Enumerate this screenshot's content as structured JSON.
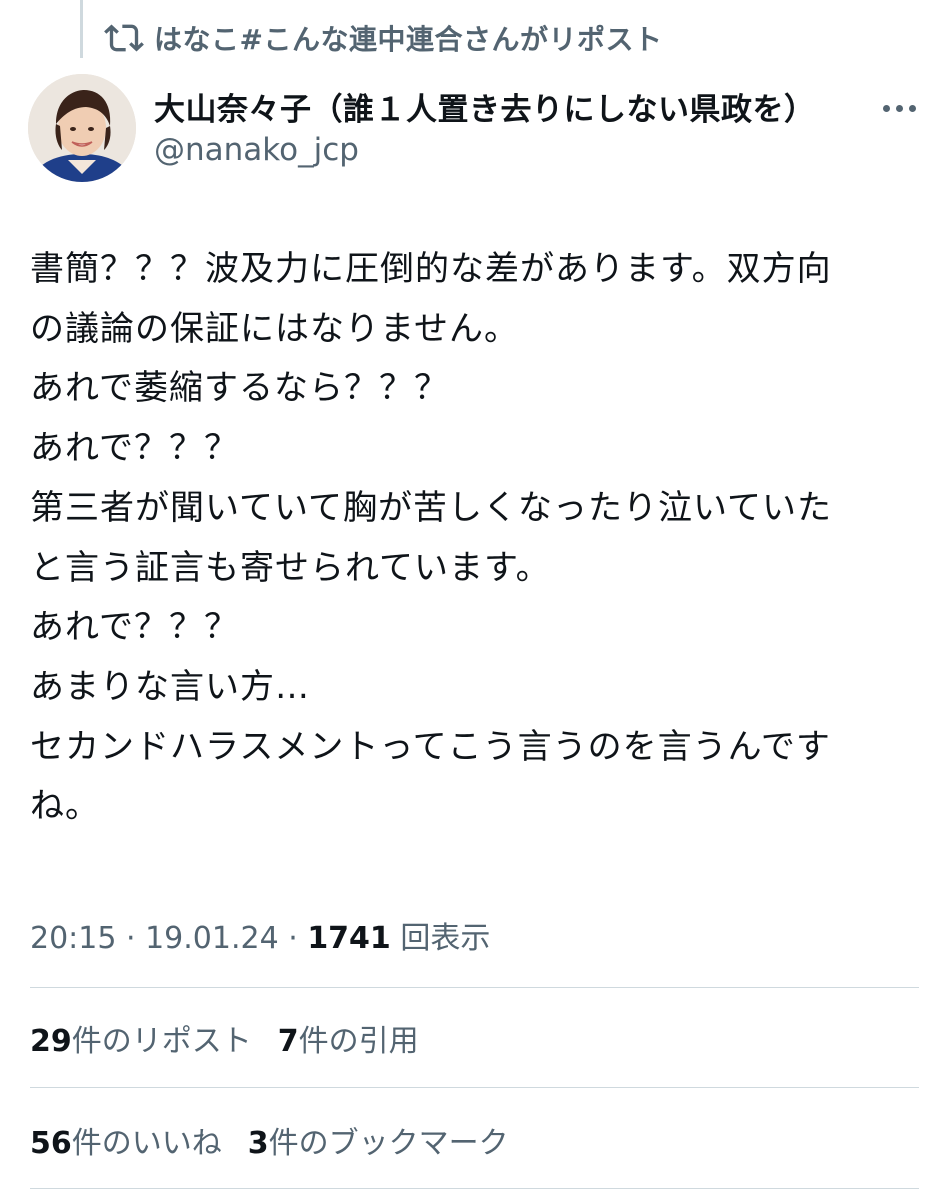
{
  "repost": {
    "text": "はなこ#こんな連中連合さんがリポスト",
    "icon": "repost-icon"
  },
  "author": {
    "display_name": "大山奈々子（誰１人置き去りにしない県政を）",
    "handle": "@nanako_jcp",
    "avatar_icon": "avatar-photo"
  },
  "tweet": {
    "lines": [
      "書簡？？？波及力に圧倒的な差があります。双方向",
      "の議論の保証にはなりません。",
      "あれで萎縮するなら？？？",
      "あれで？？？",
      "第三者が聞いていて胸が苦しくなったり泣いていた",
      "と言う証言も寄せられています。",
      "あれで？？？",
      "あまりな言い方…",
      "セカンドハラスメントってこう言うのを言うんです",
      "ね。"
    ]
  },
  "meta": {
    "time": "20:15",
    "date": "19.01.24",
    "views_count": "1741",
    "views_label": "回表示"
  },
  "stats_row1": {
    "reposts_count": "29",
    "reposts_label": "件のリポスト",
    "quotes_count": "7",
    "quotes_label": "件の引用"
  },
  "stats_row2": {
    "likes_count": "56",
    "likes_label": "件のいいね",
    "bookmarks_count": "3",
    "bookmarks_label": "件のブックマーク"
  },
  "colors": {
    "text": "#0f1419",
    "secondary": "#536471",
    "divider": "#cfd9de"
  }
}
